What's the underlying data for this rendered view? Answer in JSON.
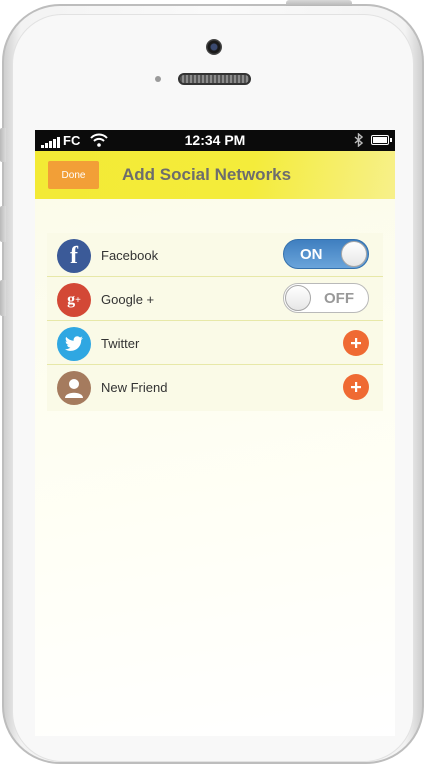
{
  "statusbar": {
    "carrier": "FC",
    "time": "12:34 PM",
    "icons": [
      "signal-icon",
      "wifi-icon",
      "bluetooth-icon",
      "battery-icon"
    ]
  },
  "navbar": {
    "done_label": "Done",
    "title": "Add Social Networks"
  },
  "networks": [
    {
      "label": "Facebook",
      "icon": "facebook-icon",
      "color": "#3b5a98",
      "control": "toggle",
      "state": "ON"
    },
    {
      "label": "Google +",
      "icon": "google-plus-icon",
      "color": "#d34836",
      "control": "toggle",
      "state": "OFF"
    },
    {
      "label": "Twitter",
      "icon": "twitter-icon",
      "color": "#2fa7e2",
      "control": "add"
    },
    {
      "label": "New Friend",
      "icon": "person-icon",
      "color": "#a57b5e",
      "control": "add"
    }
  ],
  "colors": {
    "navbar": "#f3ea35",
    "done_button": "#f29f37",
    "toggle_on": "#4f8fcf",
    "add_button": "#ef6a33"
  }
}
